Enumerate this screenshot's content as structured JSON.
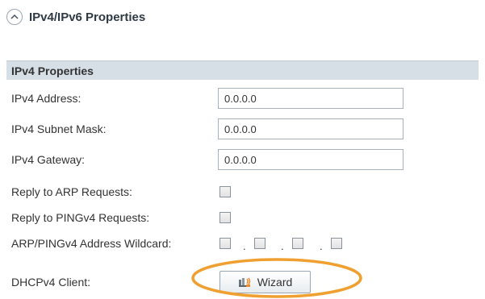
{
  "section": {
    "title": "IPv4/IPv6 Properties",
    "collapse_icon": "chevron-up-icon"
  },
  "group": {
    "title": "IPv4 Properties"
  },
  "fields": {
    "address": {
      "label": "IPv4 Address:",
      "value": "0.0.0.0"
    },
    "subnet": {
      "label": "IPv4 Subnet Mask:",
      "value": "0.0.0.0"
    },
    "gateway": {
      "label": "IPv4 Gateway:",
      "value": "0.0.0.0"
    },
    "arp": {
      "label": "Reply to ARP Requests:",
      "checked": false
    },
    "ping": {
      "label": "Reply to PINGv4 Requests:",
      "checked": false
    },
    "wildcard": {
      "label": "ARP/PINGv4 Address Wildcard:",
      "octets_checked": [
        false,
        false,
        false,
        false
      ],
      "separator": "."
    },
    "dhcp": {
      "label": "DHCPv4 Client:",
      "button_label": "Wizard",
      "button_icon": "wizard-icon"
    }
  },
  "annotation": {
    "color": "#f0a030"
  }
}
